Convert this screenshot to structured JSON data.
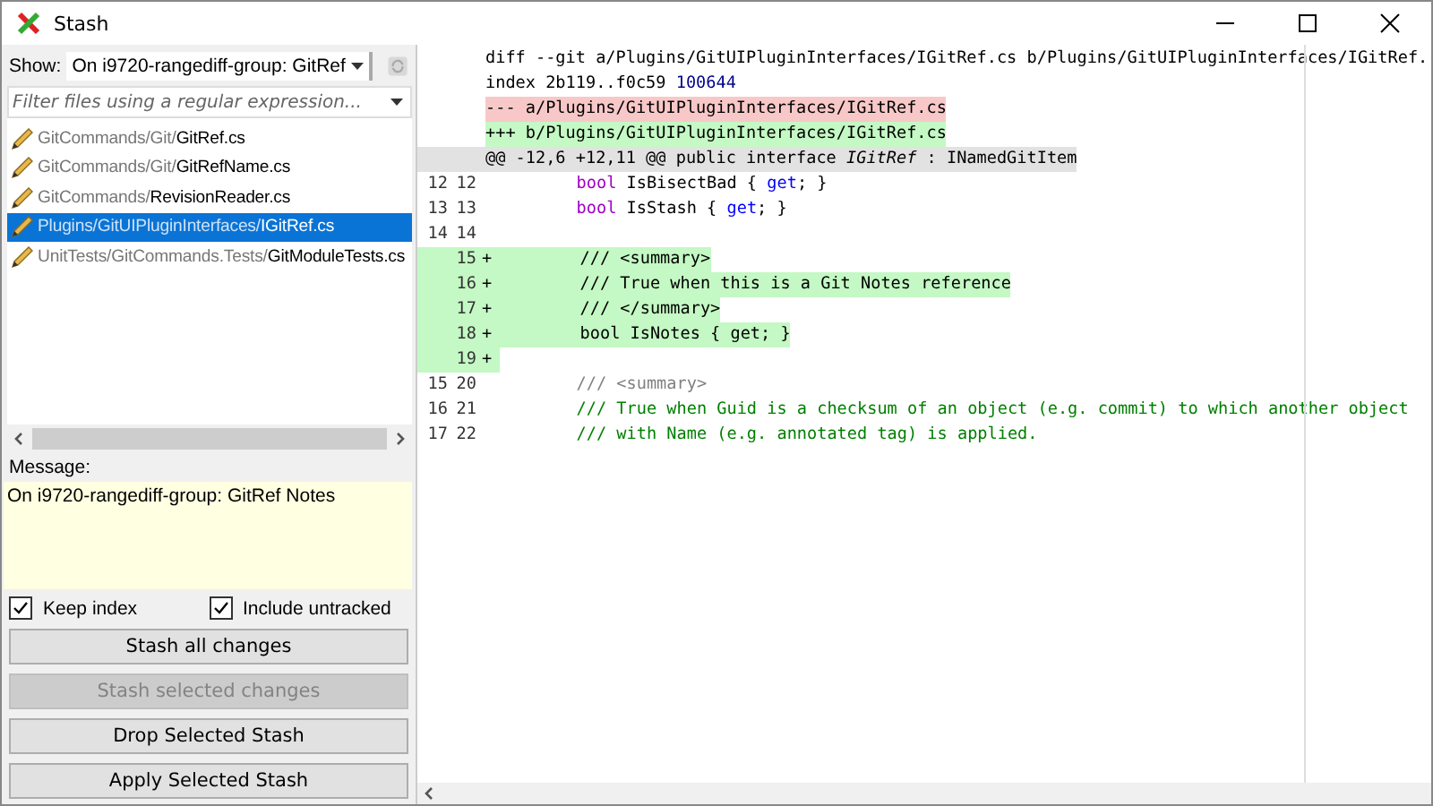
{
  "window": {
    "title": "Stash"
  },
  "show": {
    "label": "Show:",
    "value": "On i9720-rangediff-group: GitRef"
  },
  "filter": {
    "placeholder": "Filter files using a regular expression..."
  },
  "files": [
    {
      "dir": "GitCommands/Git/",
      "name": "GitRef.cs",
      "selected": false
    },
    {
      "dir": "GitCommands/Git/",
      "name": "GitRefName.cs",
      "selected": false
    },
    {
      "dir": "GitCommands/",
      "name": "RevisionReader.cs",
      "selected": false
    },
    {
      "dir": "Plugins/GitUIPluginInterfaces/",
      "name": "IGitRef.cs",
      "selected": true
    },
    {
      "dir": "UnitTests/GitCommands.Tests/",
      "name": "GitModuleTests.cs",
      "selected": false
    }
  ],
  "message": {
    "label": "Message:",
    "value": "On i9720-rangediff-group: GitRef Notes"
  },
  "options": [
    {
      "label": "Keep index",
      "checked": true
    },
    {
      "label": "Include untracked",
      "checked": true
    }
  ],
  "buttons": [
    {
      "label": "Stash all changes",
      "disabled": false
    },
    {
      "label": "Stash selected changes",
      "disabled": true
    },
    {
      "label": "Drop Selected Stash",
      "disabled": false
    },
    {
      "label": "Apply Selected Stash",
      "disabled": false
    }
  ],
  "diff": {
    "lines": [
      {
        "kind": "header",
        "segments": [
          {
            "text": "diff --git a/Plugins/GitUIPluginInterfaces/IGitRef.cs b/Plugins/GitUIPluginInterfaces/IGitRef.",
            "kind": "plain"
          }
        ]
      },
      {
        "kind": "header",
        "segments": [
          {
            "text": "index 2b119..f0c59 ",
            "kind": "plain"
          },
          {
            "text": "100644",
            "kind": "number"
          }
        ]
      },
      {
        "kind": "removed_header",
        "segments": [
          {
            "text": "--- a/Plugins/GitUIPluginInterfaces/IGitRef.cs",
            "kind": "plain"
          }
        ]
      },
      {
        "kind": "added_header",
        "segments": [
          {
            "text": "+++ b/Plugins/GitUIPluginInterfaces/IGitRef.cs",
            "kind": "plain"
          }
        ]
      },
      {
        "kind": "hunk",
        "segments": [
          {
            "text": "@@ -12,6 +12,11 @@ public interface ",
            "kind": "plain"
          },
          {
            "text": "IGitRef",
            "kind": "italic"
          },
          {
            "text": " : INamedGitItem",
            "kind": "plain"
          }
        ]
      },
      {
        "kind": "context",
        "old": "12",
        "new": "12",
        "segments": [
          {
            "text": "        bool",
            "kind": "keyword"
          },
          {
            "text": " IsBisectBad { ",
            "kind": "plain"
          },
          {
            "text": "get",
            "kind": "accessor"
          },
          {
            "text": "; }",
            "kind": "plain"
          }
        ]
      },
      {
        "kind": "context",
        "old": "13",
        "new": "13",
        "segments": [
          {
            "text": "        bool",
            "kind": "keyword"
          },
          {
            "text": " IsStash { ",
            "kind": "plain"
          },
          {
            "text": "get",
            "kind": "accessor"
          },
          {
            "text": "; }",
            "kind": "plain"
          }
        ]
      },
      {
        "kind": "context",
        "old": "14",
        "new": "14"
      },
      {
        "kind": "added",
        "new": "15",
        "sign": "+",
        "segments": [
          {
            "text": "        /// <summary>",
            "kind": "plain"
          }
        ]
      },
      {
        "kind": "added",
        "new": "16",
        "sign": "+",
        "segments": [
          {
            "text": "        /// True when this is a Git Notes reference",
            "kind": "plain"
          }
        ]
      },
      {
        "kind": "added",
        "new": "17",
        "sign": "+",
        "segments": [
          {
            "text": "        /// </summary>",
            "kind": "plain"
          }
        ]
      },
      {
        "kind": "added",
        "new": "18",
        "sign": "+",
        "segments": [
          {
            "text": "        bool IsNotes { get; }",
            "kind": "plain"
          }
        ]
      },
      {
        "kind": "added",
        "new": "19",
        "sign": "+"
      },
      {
        "kind": "context",
        "old": "15",
        "new": "20",
        "segments": [
          {
            "text": "        /// <summary>",
            "kind": "doctag"
          }
        ]
      },
      {
        "kind": "context",
        "old": "16",
        "new": "21",
        "segments": [
          {
            "text": "        /// True when Guid is a checksum of an object (e.g. commit) to which another object",
            "kind": "comment"
          }
        ]
      },
      {
        "kind": "context",
        "old": "17",
        "new": "22",
        "segments": [
          {
            "text": "        /// with Name (e.g. annotated tag) is applied.",
            "kind": "comment"
          }
        ]
      }
    ]
  }
}
